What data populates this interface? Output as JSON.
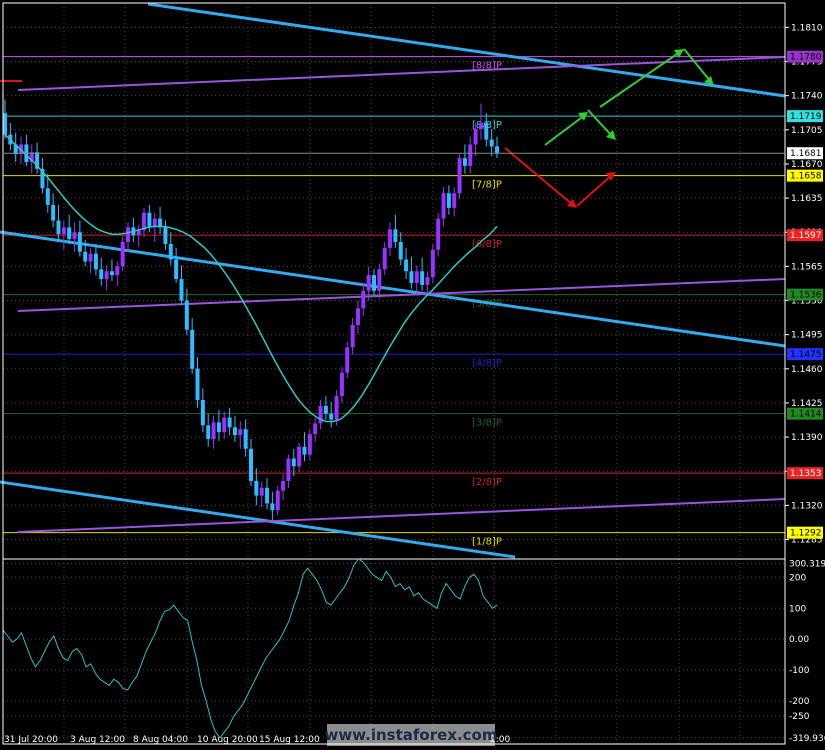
{
  "watermark": "www.instaforex.com",
  "colors": {
    "background": "#000000",
    "frame": "#ffffff",
    "grid": "#4a4a4a",
    "bull": "#9933ff",
    "bear": "#33bbff",
    "ma": "#33c6c6",
    "channel": "#33aaee",
    "purple_line": "#9955dd",
    "cci": "#33bbcc",
    "forecast_up": "#33cc33",
    "forecast_down": "#dd1111"
  },
  "chart_data": [
    {
      "type": "candlestick",
      "title": "",
      "ylim": [
        1.1265,
        1.1835
      ],
      "y_ticks": [
        "1.1810",
        "1.1775",
        "1.1740",
        "1.1705",
        "1.1670",
        "1.1635",
        "1.1600",
        "1.1565",
        "1.1530",
        "1.1495",
        "1.1460",
        "1.1425",
        "1.1390",
        "1.1355",
        "1.1320",
        "1.1285"
      ],
      "x_labels": [
        "31 Jul 20:00",
        "3 Aug 12:00",
        "8 Aug 04:00",
        "10 Aug 20:00",
        "15 Aug 12:00",
        "",
        "",
        "",
        "2:00"
      ],
      "price_label": {
        "value": "1.1681",
        "y": 1.1681
      },
      "levels": [
        {
          "label": "[8/8]P",
          "value": "1.1780",
          "y": 1.178,
          "color": "#cc55ff",
          "tag_bg": "#9933cc",
          "tag_fg": "#000000"
        },
        {
          "label": "[8/8]P",
          "value": "1.1719",
          "y": 1.1719,
          "color": "#33cccc",
          "tag_bg": "#33e0e0",
          "tag_fg": "#000000"
        },
        {
          "label": "[7/8]P",
          "value": "1.1658",
          "y": 1.1658,
          "color": "#e0e000",
          "tag_bg": "#ffff00",
          "tag_fg": "#000000"
        },
        {
          "label": "[6/8]P",
          "value": "1.1597",
          "y": 1.1597,
          "color": "#cc2222",
          "tag_bg": "#ee2222",
          "tag_fg": "#ffffff"
        },
        {
          "label": "[5/8]P",
          "value": "1.1536",
          "y": 1.1536,
          "color": "#226622",
          "tag_bg": "#228822",
          "tag_fg": "#000000"
        },
        {
          "label": "[4/8]P",
          "value": "1.1475",
          "y": 1.1475,
          "color": "#2222cc",
          "tag_bg": "#2233ff",
          "tag_fg": "#000000"
        },
        {
          "label": "[3/8]P",
          "value": "1.1414",
          "y": 1.1414,
          "color": "#226622",
          "tag_bg": "#228822",
          "tag_fg": "#000000"
        },
        {
          "label": "[2/8]P",
          "value": "1.1353",
          "y": 1.1353,
          "color": "#cc2222",
          "tag_bg": "#ee2222",
          "tag_fg": "#ffffff"
        },
        {
          "label": "[1/8]P",
          "value": "1.1292",
          "y": 1.1292,
          "color": "#e0e000",
          "tag_bg": "#ffff00",
          "tag_fg": "#000000"
        }
      ],
      "candles": [
        {
          "o": 1.1722,
          "h": 1.1736,
          "l": 1.1696,
          "c": 1.17
        },
        {
          "o": 1.17,
          "h": 1.1712,
          "l": 1.1684,
          "c": 1.169
        },
        {
          "o": 1.169,
          "h": 1.1702,
          "l": 1.1672,
          "c": 1.168
        },
        {
          "o": 1.168,
          "h": 1.1698,
          "l": 1.167,
          "c": 1.169
        },
        {
          "o": 1.169,
          "h": 1.17,
          "l": 1.1668,
          "c": 1.1672
        },
        {
          "o": 1.1672,
          "h": 1.169,
          "l": 1.166,
          "c": 1.1682
        },
        {
          "o": 1.1682,
          "h": 1.1692,
          "l": 1.166,
          "c": 1.1665
        },
        {
          "o": 1.1665,
          "h": 1.1676,
          "l": 1.164,
          "c": 1.1645
        },
        {
          "o": 1.1645,
          "h": 1.166,
          "l": 1.162,
          "c": 1.1628
        },
        {
          "o": 1.1628,
          "h": 1.164,
          "l": 1.1605,
          "c": 1.1612
        },
        {
          "o": 1.1612,
          "h": 1.1628,
          "l": 1.159,
          "c": 1.1598
        },
        {
          "o": 1.1598,
          "h": 1.1612,
          "l": 1.1582,
          "c": 1.1605
        },
        {
          "o": 1.1605,
          "h": 1.1618,
          "l": 1.1588,
          "c": 1.1593
        },
        {
          "o": 1.1593,
          "h": 1.161,
          "l": 1.158,
          "c": 1.16
        },
        {
          "o": 1.16,
          "h": 1.1612,
          "l": 1.1575,
          "c": 1.158
        },
        {
          "o": 1.158,
          "h": 1.1592,
          "l": 1.1565,
          "c": 1.157
        },
        {
          "o": 1.157,
          "h": 1.1584,
          "l": 1.1558,
          "c": 1.1578
        },
        {
          "o": 1.1578,
          "h": 1.1588,
          "l": 1.1556,
          "c": 1.1562
        },
        {
          "o": 1.1562,
          "h": 1.1574,
          "l": 1.1545,
          "c": 1.1552
        },
        {
          "o": 1.1552,
          "h": 1.1566,
          "l": 1.154,
          "c": 1.156
        },
        {
          "o": 1.156,
          "h": 1.1572,
          "l": 1.155,
          "c": 1.1556
        },
        {
          "o": 1.1556,
          "h": 1.157,
          "l": 1.1545,
          "c": 1.1565
        },
        {
          "o": 1.1565,
          "h": 1.1596,
          "l": 1.156,
          "c": 1.159
        },
        {
          "o": 1.159,
          "h": 1.161,
          "l": 1.158,
          "c": 1.1605
        },
        {
          "o": 1.1605,
          "h": 1.1615,
          "l": 1.159,
          "c": 1.1597
        },
        {
          "o": 1.1597,
          "h": 1.1608,
          "l": 1.1585,
          "c": 1.1602
        },
        {
          "o": 1.1602,
          "h": 1.1625,
          "l": 1.1595,
          "c": 1.162
        },
        {
          "o": 1.162,
          "h": 1.1628,
          "l": 1.16,
          "c": 1.1606
        },
        {
          "o": 1.1606,
          "h": 1.162,
          "l": 1.159,
          "c": 1.1614
        },
        {
          "o": 1.1614,
          "h": 1.1626,
          "l": 1.1598,
          "c": 1.1605
        },
        {
          "o": 1.1605,
          "h": 1.1612,
          "l": 1.1582,
          "c": 1.1588
        },
        {
          "o": 1.1588,
          "h": 1.16,
          "l": 1.1566,
          "c": 1.1572
        },
        {
          "o": 1.1572,
          "h": 1.1584,
          "l": 1.1548,
          "c": 1.1552
        },
        {
          "o": 1.1552,
          "h": 1.1566,
          "l": 1.1525,
          "c": 1.153
        },
        {
          "o": 1.153,
          "h": 1.1542,
          "l": 1.1495,
          "c": 1.15
        },
        {
          "o": 1.15,
          "h": 1.1512,
          "l": 1.1455,
          "c": 1.146
        },
        {
          "o": 1.146,
          "h": 1.1472,
          "l": 1.142,
          "c": 1.1428
        },
        {
          "o": 1.1428,
          "h": 1.144,
          "l": 1.1395,
          "c": 1.1402
        },
        {
          "o": 1.1402,
          "h": 1.1414,
          "l": 1.138,
          "c": 1.1388
        },
        {
          "o": 1.1388,
          "h": 1.1412,
          "l": 1.1378,
          "c": 1.1405
        },
        {
          "o": 1.1405,
          "h": 1.1418,
          "l": 1.1386,
          "c": 1.1395
        },
        {
          "o": 1.1395,
          "h": 1.1416,
          "l": 1.1388,
          "c": 1.141
        },
        {
          "o": 1.141,
          "h": 1.142,
          "l": 1.1392,
          "c": 1.14
        },
        {
          "o": 1.14,
          "h": 1.1412,
          "l": 1.1385,
          "c": 1.1392
        },
        {
          "o": 1.1392,
          "h": 1.1406,
          "l": 1.1378,
          "c": 1.1398
        },
        {
          "o": 1.1398,
          "h": 1.1408,
          "l": 1.137,
          "c": 1.1378
        },
        {
          "o": 1.1378,
          "h": 1.1388,
          "l": 1.134,
          "c": 1.1345
        },
        {
          "o": 1.1345,
          "h": 1.1358,
          "l": 1.132,
          "c": 1.133
        },
        {
          "o": 1.133,
          "h": 1.1344,
          "l": 1.1318,
          "c": 1.1338
        },
        {
          "o": 1.1338,
          "h": 1.1348,
          "l": 1.1316,
          "c": 1.1322
        },
        {
          "o": 1.1322,
          "h": 1.1334,
          "l": 1.1305,
          "c": 1.1315
        },
        {
          "o": 1.1315,
          "h": 1.134,
          "l": 1.131,
          "c": 1.1335
        },
        {
          "o": 1.1335,
          "h": 1.1352,
          "l": 1.1325,
          "c": 1.1345
        },
        {
          "o": 1.1345,
          "h": 1.1372,
          "l": 1.1338,
          "c": 1.1368
        },
        {
          "o": 1.1368,
          "h": 1.1378,
          "l": 1.135,
          "c": 1.136
        },
        {
          "o": 1.136,
          "h": 1.1384,
          "l": 1.1354,
          "c": 1.138
        },
        {
          "o": 1.138,
          "h": 1.1395,
          "l": 1.1365,
          "c": 1.1372
        },
        {
          "o": 1.1372,
          "h": 1.1398,
          "l": 1.1366,
          "c": 1.1393
        },
        {
          "o": 1.1393,
          "h": 1.141,
          "l": 1.1385,
          "c": 1.1404
        },
        {
          "o": 1.1404,
          "h": 1.1428,
          "l": 1.1398,
          "c": 1.1422
        },
        {
          "o": 1.1422,
          "h": 1.1432,
          "l": 1.1408,
          "c": 1.1414
        },
        {
          "o": 1.1414,
          "h": 1.1426,
          "l": 1.14,
          "c": 1.1408
        },
        {
          "o": 1.1408,
          "h": 1.1438,
          "l": 1.1402,
          "c": 1.1432
        },
        {
          "o": 1.1432,
          "h": 1.1462,
          "l": 1.1425,
          "c": 1.1456
        },
        {
          "o": 1.1456,
          "h": 1.1488,
          "l": 1.145,
          "c": 1.1482
        },
        {
          "o": 1.1482,
          "h": 1.1512,
          "l": 1.1475,
          "c": 1.1505
        },
        {
          "o": 1.1505,
          "h": 1.153,
          "l": 1.1496,
          "c": 1.1522
        },
        {
          "o": 1.1522,
          "h": 1.1548,
          "l": 1.1514,
          "c": 1.154
        },
        {
          "o": 1.154,
          "h": 1.1565,
          "l": 1.153,
          "c": 1.1556
        },
        {
          "o": 1.1556,
          "h": 1.1562,
          "l": 1.1535,
          "c": 1.154
        },
        {
          "o": 1.154,
          "h": 1.1568,
          "l": 1.1532,
          "c": 1.1562
        },
        {
          "o": 1.1562,
          "h": 1.159,
          "l": 1.1556,
          "c": 1.1584
        },
        {
          "o": 1.1584,
          "h": 1.161,
          "l": 1.1576,
          "c": 1.1603
        },
        {
          "o": 1.1603,
          "h": 1.1618,
          "l": 1.1584,
          "c": 1.159
        },
        {
          "o": 1.159,
          "h": 1.16,
          "l": 1.1566,
          "c": 1.1572
        },
        {
          "o": 1.1572,
          "h": 1.1584,
          "l": 1.1552,
          "c": 1.156
        },
        {
          "o": 1.156,
          "h": 1.1575,
          "l": 1.1542,
          "c": 1.1548
        },
        {
          "o": 1.1548,
          "h": 1.1566,
          "l": 1.1535,
          "c": 1.156
        },
        {
          "o": 1.156,
          "h": 1.1574,
          "l": 1.154,
          "c": 1.1546
        },
        {
          "o": 1.1546,
          "h": 1.156,
          "l": 1.1535,
          "c": 1.1554
        },
        {
          "o": 1.1554,
          "h": 1.1588,
          "l": 1.1548,
          "c": 1.1582
        },
        {
          "o": 1.1582,
          "h": 1.162,
          "l": 1.1575,
          "c": 1.1614
        },
        {
          "o": 1.1614,
          "h": 1.1646,
          "l": 1.1606,
          "c": 1.164
        },
        {
          "o": 1.164,
          "h": 1.1648,
          "l": 1.1618,
          "c": 1.1625
        },
        {
          "o": 1.1625,
          "h": 1.1646,
          "l": 1.1616,
          "c": 1.164
        },
        {
          "o": 1.164,
          "h": 1.168,
          "l": 1.1634,
          "c": 1.1676
        },
        {
          "o": 1.1676,
          "h": 1.169,
          "l": 1.166,
          "c": 1.1668
        },
        {
          "o": 1.1668,
          "h": 1.1698,
          "l": 1.166,
          "c": 1.169
        },
        {
          "o": 1.169,
          "h": 1.1712,
          "l": 1.1678,
          "c": 1.1706
        },
        {
          "o": 1.1706,
          "h": 1.1732,
          "l": 1.1695,
          "c": 1.1712
        },
        {
          "o": 1.1712,
          "h": 1.1722,
          "l": 1.1688,
          "c": 1.1695
        },
        {
          "o": 1.1695,
          "h": 1.1706,
          "l": 1.1678,
          "c": 1.1688
        },
        {
          "o": 1.1688,
          "h": 1.1698,
          "l": 1.1676,
          "c": 1.1681
        }
      ],
      "ma": [
        1.17,
        1.1693,
        1.1686,
        1.1679,
        1.1672,
        1.1664,
        1.1656,
        1.1647,
        1.1638,
        1.1629,
        1.1621,
        1.1614,
        1.1608,
        1.1603,
        1.16,
        1.1598,
        1.1598,
        1.1599,
        1.1601,
        1.1603,
        1.1605,
        1.1606,
        1.1606,
        1.1605,
        1.1603,
        1.16,
        1.1596,
        1.159,
        1.1584,
        1.1576,
        1.1567,
        1.1557,
        1.1546,
        1.1534,
        1.1521,
        1.1508,
        1.1494,
        1.148,
        1.1466,
        1.1453,
        1.1441,
        1.143,
        1.1421,
        1.1414,
        1.1409,
        1.1406,
        1.1406,
        1.1408,
        1.1414,
        1.1422,
        1.1432,
        1.1444,
        1.1457,
        1.147,
        1.1483,
        1.1495,
        1.1507,
        1.1517,
        1.1526,
        1.1534,
        1.1541,
        1.1549,
        1.1557,
        1.1565,
        1.1572,
        1.1579,
        1.1585,
        1.1592,
        1.1598,
        1.1606
      ]
    },
    {
      "type": "line",
      "title": "",
      "ylim": [
        -340,
        250
      ],
      "y_ticks": [
        "300.3195",
        "200",
        "100",
        "0.00",
        "-100",
        "-200",
        "-250",
        "-319.936"
      ],
      "series": [
        {
          "values": [
            30,
            10,
            -10,
            0,
            20,
            -20,
            -60,
            -90,
            -70,
            -40,
            -10,
            10,
            -30,
            -60,
            -70,
            -40,
            -30,
            -50,
            -90,
            -80,
            -110,
            -130,
            -140,
            -150,
            -130,
            -140,
            -160,
            -165,
            -140,
            -120,
            -80,
            -40,
            -10,
            20,
            60,
            90,
            95,
            110,
            90,
            70,
            60,
            -10,
            -70,
            -150,
            -200,
            -260,
            -300,
            -320,
            -300,
            -280,
            -250,
            -230,
            -210,
            -180,
            -150,
            -120,
            -90,
            -60,
            -40,
            -20,
            0,
            30,
            60,
            110,
            150,
            210,
            230,
            210,
            190,
            160,
            120,
            110,
            130,
            150,
            170,
            200,
            240,
            260,
            250,
            230,
            210,
            200,
            190,
            220,
            200,
            170,
            180,
            160,
            170,
            140,
            150,
            130,
            120,
            110,
            100,
            150,
            180,
            160,
            140,
            130,
            170,
            200,
            210,
            190,
            140,
            120,
            100,
            110
          ]
        }
      ]
    }
  ]
}
